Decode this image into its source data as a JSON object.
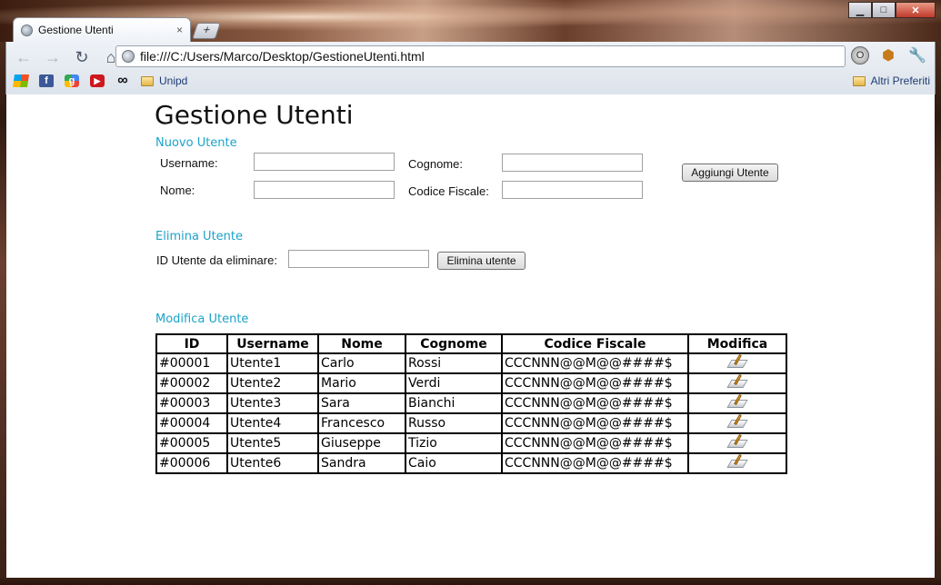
{
  "browser": {
    "tab_title": "Gestione Utenti",
    "tab_close": "×",
    "new_tab": "+",
    "address": "file:///C:/Users/Marco/Desktop/GestioneUtenti.html",
    "window_controls": {
      "minimize": "▁",
      "maximize": "□",
      "close": "✕"
    },
    "nav": {
      "back": "←",
      "forward": "→",
      "reload": "↻",
      "home": "⌂"
    },
    "bookmarks": [
      {
        "label": "",
        "icon": "windows-icon"
      },
      {
        "label": "",
        "icon": "facebook-icon",
        "glyph": "f"
      },
      {
        "label": "",
        "icon": "google-icon",
        "glyph": "g"
      },
      {
        "label": "",
        "icon": "youtube-icon",
        "glyph": "▶"
      },
      {
        "label": "",
        "icon": "infinity-icon",
        "glyph": "∞"
      },
      {
        "label": "Unipd",
        "icon": "folder-icon"
      }
    ],
    "other_bookmarks": "Altri Preferiti",
    "extensions": {
      "ext1": "O",
      "ext2": "⬢",
      "wrench": "🔧"
    }
  },
  "page": {
    "title": "Gestione Utenti",
    "new_user": {
      "heading": "Nuovo Utente",
      "username_label": "Username:",
      "cognome_label": "Cognome:",
      "nome_label": "Nome:",
      "cf_label": "Codice Fiscale:",
      "submit": "Aggiungi Utente",
      "values": {
        "username": "",
        "cognome": "",
        "nome": "",
        "cf": ""
      }
    },
    "delete_user": {
      "heading": "Elimina Utente",
      "id_label": "ID Utente da eliminare:",
      "id_value": "",
      "submit": "Elimina utente"
    },
    "edit_user": {
      "heading": "Modifica Utente",
      "columns": [
        "ID",
        "Username",
        "Nome",
        "Cognome",
        "Codice Fiscale",
        "Modifica"
      ],
      "rows": [
        [
          "#00001",
          "Utente1",
          "Carlo",
          "Rossi",
          "CCCNNN@@M@@####$"
        ],
        [
          "#00002",
          "Utente2",
          "Mario",
          "Verdi",
          "CCCNNN@@M@@####$"
        ],
        [
          "#00003",
          "Utente3",
          "Sara",
          "Bianchi",
          "CCCNNN@@M@@####$"
        ],
        [
          "#00004",
          "Utente4",
          "Francesco",
          "Russo",
          "CCCNNN@@M@@####$"
        ],
        [
          "#00005",
          "Utente5",
          "Giuseppe",
          "Tizio",
          "CCCNNN@@M@@####$"
        ],
        [
          "#00006",
          "Utente6",
          "Sandra",
          "Caio",
          "CCCNNN@@M@@####$"
        ]
      ],
      "row_action_icon": "edit-icon"
    }
  },
  "colors": {
    "section_heading": "#1ca3c9"
  }
}
